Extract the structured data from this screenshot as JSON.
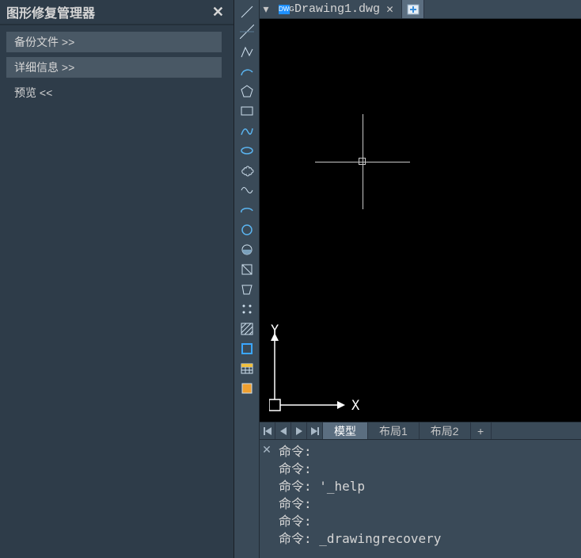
{
  "panel": {
    "title": "图形修复管理器",
    "backup_files": "备份文件 >>",
    "details": "详细信息 >>",
    "preview": "预览 <<"
  },
  "tool_icons": [
    "line-icon",
    "construction-line-icon",
    "polyline-icon",
    "arc-icon",
    "polygon-icon",
    "rectangle-icon",
    "spline-fit-icon",
    "ellipse-icon",
    "revision-cloud-icon",
    "spline-cv-icon",
    "ellipse-arc-icon",
    "circle-icon",
    "donut-icon",
    "region-icon",
    "wipeout-icon",
    "divide-icon",
    "hatch-icon",
    "boundary-icon",
    "table-icon",
    "point-icon"
  ],
  "docs": {
    "active": "Drawing1.dwg"
  },
  "layout": {
    "model": "模型",
    "layout1": "布局1",
    "layout2": "布局2"
  },
  "ucs": {
    "x": "X",
    "y": "Y"
  },
  "cmd": {
    "l1": "命令:",
    "l2": "命令:",
    "l3": "命令: '_help",
    "l4": "命令:",
    "l5": "命令:",
    "l6": "命令: _drawingrecovery"
  }
}
